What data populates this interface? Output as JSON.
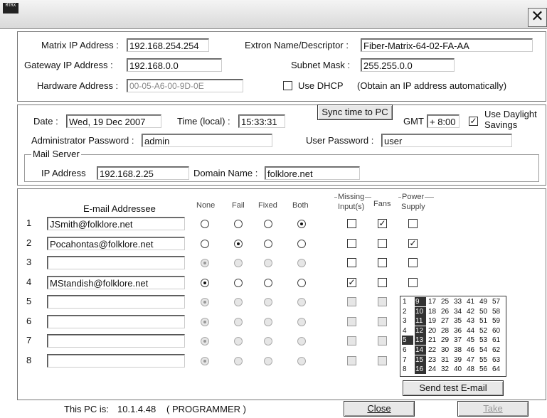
{
  "window": {
    "icon_text": "MTRX"
  },
  "network": {
    "matrix_ip_label": "Matrix IP Address :",
    "matrix_ip": "192.168.254.254",
    "gateway_label": "Gateway IP Address :",
    "gateway": "192.168.0.0",
    "hardware_label": "Hardware Address :",
    "hardware": "00-05-A6-00-9D-0E",
    "name_label": "Extron Name/Descriptor :",
    "name": "Fiber-Matrix-64-02-FA-AA",
    "subnet_label": "Subnet Mask :",
    "subnet": "255.255.0.0",
    "dhcp_label": "Use DHCP",
    "dhcp_hint": "(Obtain an IP address automatically)",
    "dhcp_checked": false
  },
  "time": {
    "date_label": "Date :",
    "date": "Wed, 19 Dec 2007",
    "time_label": "Time (local) :",
    "time": "15:33:31",
    "sync_button": "Sync time to PC",
    "gmt_label": "GMT",
    "gmt": "+ 8:00",
    "daylight_label_1": "Use Daylight",
    "daylight_label_2": "Savings",
    "daylight_checked": true,
    "admin_pw_label": "Administrator Password :",
    "admin_pw": "admin",
    "user_pw_label": "User Password :",
    "user_pw": "user"
  },
  "mail_server": {
    "legend": "Mail Server",
    "ip_label": "IP Address",
    "ip": "192.168.2.25",
    "domain_label": "Domain Name :",
    "domain": "folklore.net"
  },
  "email": {
    "header_addressee": "E-mail Addressee",
    "header_none": "None",
    "header_fail": "Fail",
    "header_fixed": "Fixed",
    "header_both": "Both",
    "header_missing_1": "Missing",
    "header_missing_2": "Input(s)",
    "header_fans": "Fans",
    "header_power_1": "Power",
    "header_power_2": "Supply",
    "rows": [
      {
        "num": "1",
        "addr": "JSmith@folklore.net"
      },
      {
        "num": "2",
        "addr": "Pocahontas@folklore.net"
      },
      {
        "num": "3",
        "addr": ""
      },
      {
        "num": "4",
        "addr": "MStandish@folklore.net"
      },
      {
        "num": "5",
        "addr": ""
      },
      {
        "num": "6",
        "addr": ""
      },
      {
        "num": "7",
        "addr": ""
      },
      {
        "num": "8",
        "addr": ""
      }
    ],
    "send_test": "Send test E-mail"
  },
  "grid": {
    "columns": [
      [
        "1",
        "2",
        "3",
        "4",
        "5",
        "6",
        "7",
        "8"
      ],
      [
        "9",
        "10",
        "11",
        "12",
        "13",
        "14",
        "15",
        "16"
      ],
      [
        "17",
        "18",
        "19",
        "20",
        "21",
        "22",
        "23",
        "24"
      ],
      [
        "25",
        "26",
        "27",
        "28",
        "29",
        "30",
        "31",
        "32"
      ],
      [
        "33",
        "34",
        "35",
        "36",
        "37",
        "38",
        "39",
        "40"
      ],
      [
        "41",
        "42",
        "43",
        "44",
        "45",
        "46",
        "47",
        "48"
      ],
      [
        "49",
        "50",
        "51",
        "52",
        "53",
        "54",
        "55",
        "56"
      ],
      [
        "57",
        "58",
        "59",
        "60",
        "61",
        "62",
        "63",
        "64"
      ]
    ]
  },
  "footer": {
    "pc_label": "This PC is:",
    "pc_ip": "10.1.4.48",
    "pc_role": "( PROGRAMMER )",
    "close_button": "Close",
    "take_button": "Take"
  }
}
